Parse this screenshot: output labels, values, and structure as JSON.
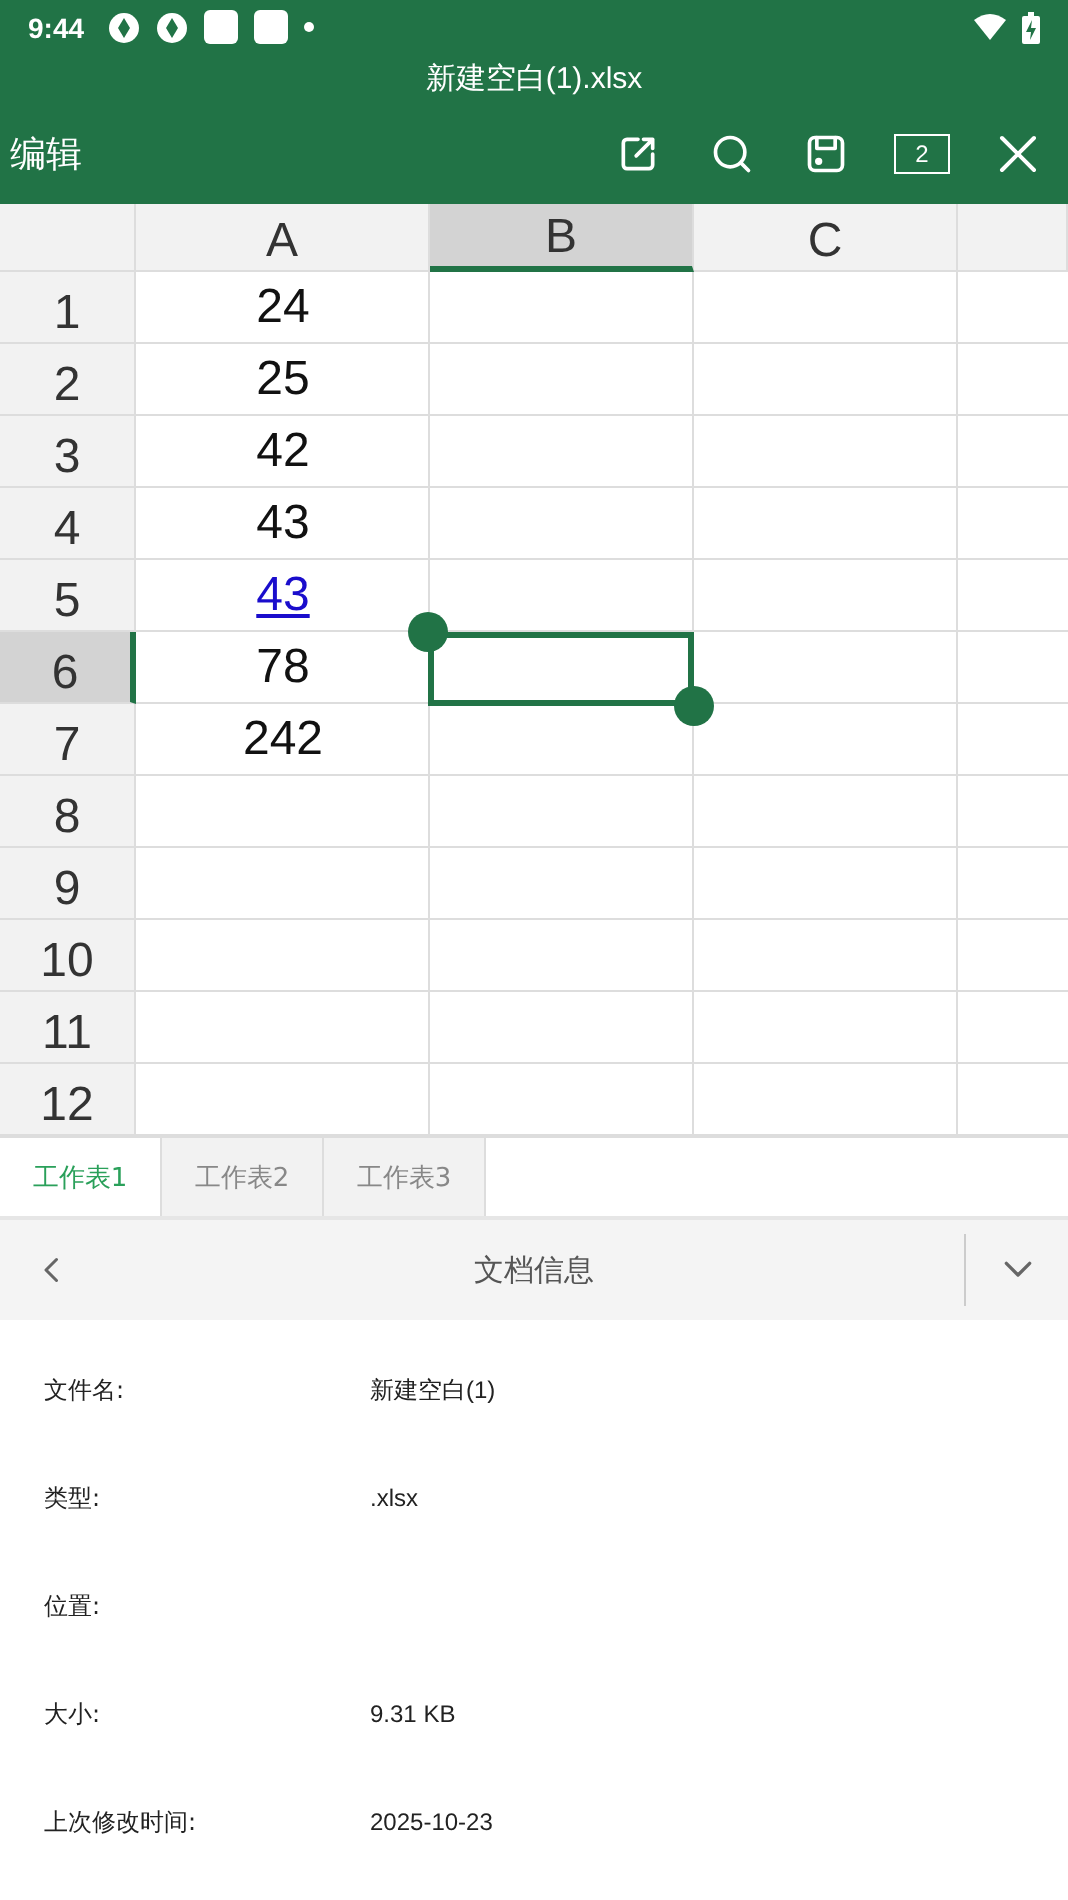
{
  "status_bar": {
    "time": "9:44"
  },
  "title": "新建空白(1).xlsx",
  "toolbar": {
    "label": "编辑",
    "window_count": "2"
  },
  "columns": [
    {
      "label": "A",
      "selected": false
    },
    {
      "label": "B",
      "selected": true
    },
    {
      "label": "C",
      "selected": false
    },
    {
      "selected": false
    }
  ],
  "rows": [
    {
      "label": "1",
      "selected": false,
      "cells": [
        {
          "text": "24",
          "kind": "plain"
        }
      ]
    },
    {
      "label": "2",
      "selected": false,
      "cells": [
        {
          "text": "25",
          "kind": "plain"
        }
      ]
    },
    {
      "label": "3",
      "selected": false,
      "cells": [
        {
          "text": "42",
          "kind": "plain"
        }
      ]
    },
    {
      "label": "4",
      "selected": false,
      "cells": [
        {
          "text": "43",
          "kind": "plain"
        }
      ]
    },
    {
      "label": "5",
      "selected": false,
      "cells": [
        {
          "text": "43",
          "kind": "link"
        }
      ]
    },
    {
      "label": "6",
      "selected": true,
      "cells": [
        {
          "text": "78",
          "kind": "plain"
        }
      ]
    },
    {
      "label": "7",
      "selected": false,
      "cells": [
        {
          "text": "242",
          "kind": "plain"
        }
      ]
    },
    {
      "label": "8",
      "selected": false,
      "cells": []
    },
    {
      "label": "9",
      "selected": false,
      "cells": []
    },
    {
      "label": "10",
      "selected": false,
      "cells": []
    },
    {
      "label": "11",
      "selected": false,
      "cells": []
    },
    {
      "label": "12",
      "selected": false,
      "cells": []
    }
  ],
  "sheet_tabs": [
    {
      "label": "工作表1",
      "selected": true
    },
    {
      "label": "工作表2",
      "selected": false
    },
    {
      "label": "工作表3",
      "selected": false
    }
  ],
  "info_panel": {
    "title": "文档信息",
    "fields": [
      {
        "label": "文件名:",
        "value": "新建空白(1)"
      },
      {
        "label": "类型:",
        "value": ".xlsx"
      },
      {
        "label": "位置:"
      },
      {
        "label": "大小:",
        "value": "9.31 KB"
      },
      {
        "label": "上次修改时间:",
        "value": "2025-10-23"
      }
    ]
  }
}
